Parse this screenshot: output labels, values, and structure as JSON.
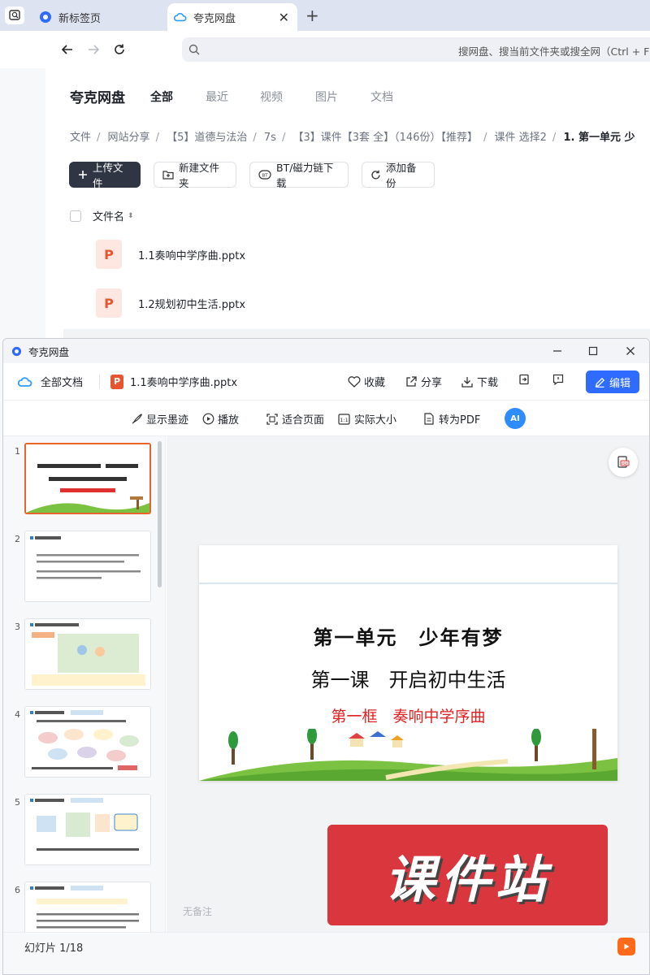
{
  "browser": {
    "tabs": [
      {
        "label": "新标签页",
        "active": false
      },
      {
        "label": "夸克网盘",
        "active": true
      }
    ],
    "address_placeholder": "搜网盘、搜当前文件夹或搜全网（Ctrl + F）"
  },
  "drive": {
    "brand": "夸克网盘",
    "nav": [
      "全部",
      "最近",
      "视频",
      "图片",
      "文档"
    ],
    "breadcrumbs": [
      "文件",
      "网站分享",
      "【5】道德与法治",
      "7s",
      "【3】课件【3套 全】（146份）【推荐】",
      "课件 选择2"
    ],
    "breadcrumb_current": "1. 第一单元 少",
    "actions": {
      "upload": "上传文件",
      "new_folder": "新建文件夹",
      "bt": "BT/磁力链下载",
      "backup": "添加备份"
    },
    "file_header": "文件名",
    "files": [
      {
        "name": "1.1奏响中学序曲.pptx",
        "icon": "P"
      },
      {
        "name": "1.2规划初中生活.pptx",
        "icon": "P"
      }
    ]
  },
  "viewer": {
    "window_title": "夸克网盘",
    "all_docs": "全部文档",
    "file_name": "1.1奏响中学序曲.pptx",
    "file_icon": "P",
    "actions": {
      "favorite": "收藏",
      "share": "分享",
      "download": "下载",
      "edit": "编辑"
    },
    "toolbar": {
      "ink": "显示墨迹",
      "play": "播放",
      "fit": "适合页面",
      "actual": "实际大小",
      "to_pdf": "转为PDF",
      "ai": "AI"
    },
    "thumbnails": [
      "1",
      "2",
      "3",
      "4",
      "5",
      "6"
    ],
    "slide": {
      "title": "第一单元　少年有梦",
      "subtitle": "第一课　开启初中生活",
      "red_line": "第一框　奏响中学序曲"
    },
    "notes_placeholder": "无备注",
    "status": "幻灯片 1/18",
    "watermark": "课件站"
  }
}
